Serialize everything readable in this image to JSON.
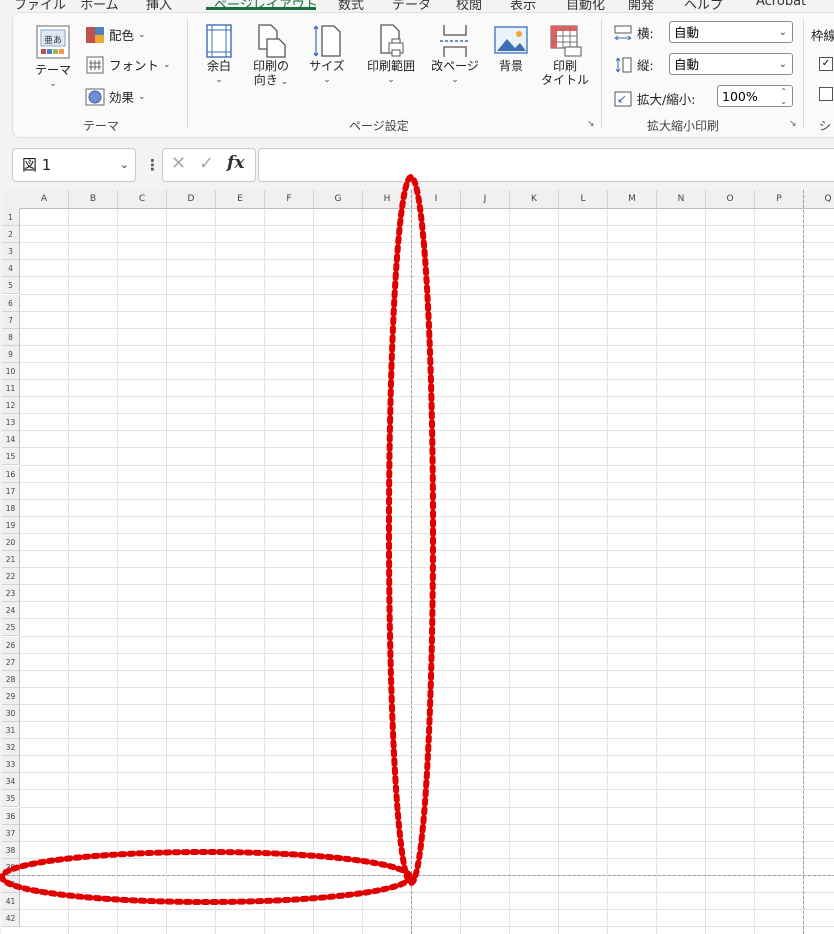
{
  "menubar": {
    "tabs": [
      {
        "label": "ファイル",
        "active": false
      },
      {
        "label": "ホーム",
        "active": false
      },
      {
        "label": "挿入",
        "active": false
      },
      {
        "label": "ページレイアウト",
        "active": true
      },
      {
        "label": "数式",
        "active": false
      },
      {
        "label": "データ",
        "active": false
      },
      {
        "label": "校閲",
        "active": false
      },
      {
        "label": "表示",
        "active": false
      },
      {
        "label": "自動化",
        "active": false
      },
      {
        "label": "開発",
        "active": false
      },
      {
        "label": "ヘルプ",
        "active": false
      },
      {
        "label": "Acrobat",
        "active": false
      }
    ]
  },
  "ribbon": {
    "theme_group": {
      "label": "テーマ",
      "themes_button": "テーマ",
      "colors_button": "配色",
      "fonts_button": "フォント",
      "effects_button": "効果"
    },
    "page_setup_group": {
      "label": "ページ設定",
      "margins": "余白",
      "orientation_line1": "印刷の",
      "orientation_line2": "向き",
      "size": "サイズ",
      "print_area": "印刷範囲",
      "breaks": "改ページ",
      "background": "背景",
      "print_titles_line1": "印刷",
      "print_titles_line2": "タイトル"
    },
    "scale_group": {
      "label": "拡大縮小印刷",
      "width_label": "横:",
      "width_value": "自動",
      "height_label": "縦:",
      "height_value": "自動",
      "scale_label": "拡大/縮小:",
      "scale_value": "100%"
    },
    "sheet_options_group": {
      "label_partial": "シ",
      "gridlines_partial": "枠線"
    }
  },
  "formula_bar": {
    "name_box": "図 1",
    "fx": "fx",
    "formula": ""
  },
  "sheet": {
    "columns": [
      "A",
      "B",
      "C",
      "D",
      "E",
      "F",
      "G",
      "H",
      "I",
      "J",
      "K",
      "L",
      "M",
      "N",
      "O",
      "P",
      "Q"
    ],
    "rows": [
      "1",
      "2",
      "3",
      "4",
      "5",
      "6",
      "7",
      "8",
      "9",
      "10",
      "11",
      "12",
      "13",
      "14",
      "15",
      "16",
      "17",
      "18",
      "19",
      "20",
      "21",
      "22",
      "23",
      "24",
      "25",
      "26",
      "27",
      "28",
      "29",
      "30",
      "31",
      "32",
      "33",
      "34",
      "35",
      "36",
      "37",
      "38",
      "39",
      "40",
      "41",
      "42"
    ]
  },
  "colors": {
    "accent": "#1b6e3c",
    "annotation": "#e00000",
    "page_break": "#9a9a9a"
  }
}
